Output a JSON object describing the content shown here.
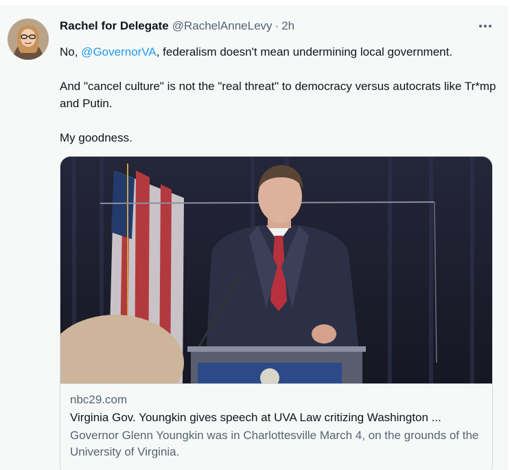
{
  "tweet": {
    "author": {
      "display_name": "Rachel for Delegate",
      "handle": "@RachelAnneLevy",
      "separator": "·",
      "time": "2h",
      "avatar_icon": "user-avatar-photo"
    },
    "more_icon": "more-options-icon",
    "text": {
      "line1_prefix": "No, ",
      "mention": "@GovernorVA",
      "line1_suffix": ", federalism doesn't mean undermining local government.",
      "paragraph2": "And \"cancel culture\" is not the \"real threat\" to democracy versus autocrats like Tr*mp and Putin.",
      "paragraph3": "My goodness."
    },
    "card": {
      "image_icon": "speech-photo",
      "domain": "nbc29.com",
      "title": "Virginia Gov. Youngkin gives speech at UVA Law critizing Washington ...",
      "description": "Governor Glenn Youngkin was in Charlottesville March 4, on the grounds of the University of Virginia."
    }
  },
  "colors": {
    "link": "#1d9bf0",
    "secondary_text": "#536471",
    "primary_text": "#0f1419",
    "background": "#f7f9f9",
    "border": "#cfd9de"
  }
}
